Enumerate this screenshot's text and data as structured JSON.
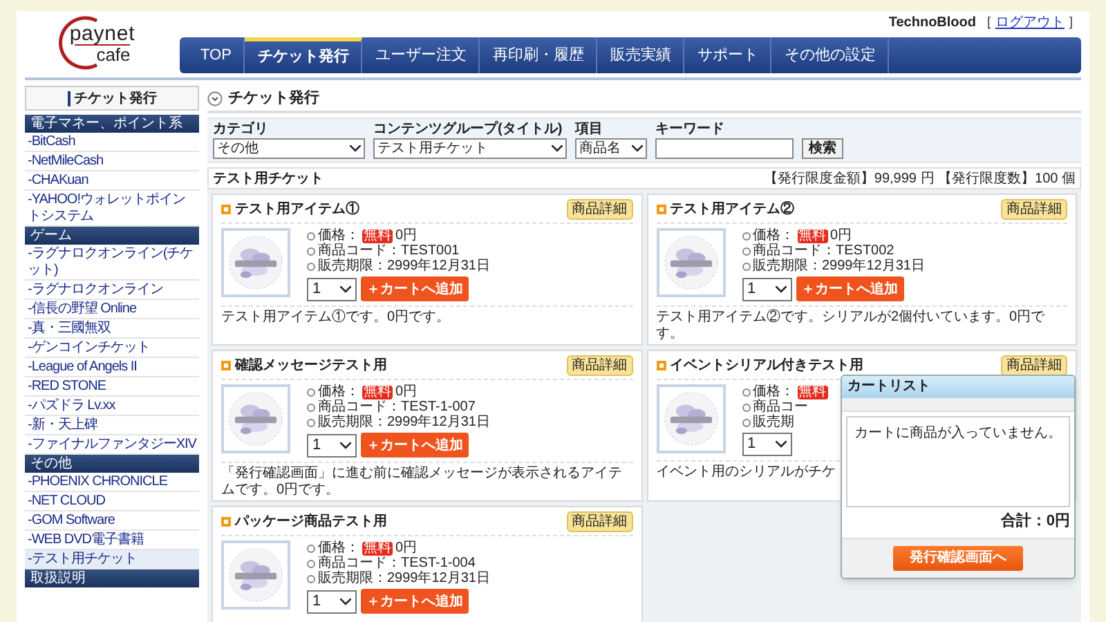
{
  "header": {
    "logo_top": "paynet",
    "logo_bottom": "cafe",
    "user": "TechnoBlood",
    "logout_open": "［",
    "logout": "ログアウト",
    "logout_close": "］"
  },
  "nav": [
    {
      "label": "TOP",
      "selected": false
    },
    {
      "label": "チケット発行",
      "selected": true
    },
    {
      "label": "ユーザー注文",
      "selected": false
    },
    {
      "label": "再印刷・履歴",
      "selected": false
    },
    {
      "label": "販売実績",
      "selected": false
    },
    {
      "label": "サポート",
      "selected": false
    },
    {
      "label": "その他の設定",
      "selected": false
    }
  ],
  "sidebar": {
    "title": "チケット発行",
    "sections": [
      {
        "heading": "電子マネー、ポイント系",
        "items": [
          {
            "label": "-BitCash",
            "selected": false
          },
          {
            "label": "-NetMileCash",
            "selected": false
          },
          {
            "label": "-CHAKuan",
            "selected": false
          },
          {
            "label": "-YAHOO!ウォレットポイントシステム",
            "selected": false
          }
        ]
      },
      {
        "heading": "ゲーム",
        "items": [
          {
            "label": "-ラグナロクオンライン(チケット)",
            "selected": false
          },
          {
            "label": "-ラグナロクオンライン",
            "selected": false
          },
          {
            "label": "-信長の野望 Online",
            "selected": false
          },
          {
            "label": "-真・三國無双",
            "selected": false
          },
          {
            "label": "-ゲンコインチケット",
            "selected": false
          },
          {
            "label": "-League of Angels II",
            "selected": false
          },
          {
            "label": "-RED STONE",
            "selected": false
          },
          {
            "label": "-パズドラ Lv.xx",
            "selected": false
          },
          {
            "label": "-新・天上碑",
            "selected": false
          },
          {
            "label": "-ファイナルファンタジーXIV",
            "selected": false
          }
        ]
      },
      {
        "heading": "その他",
        "items": [
          {
            "label": "-PHOENIX CHRONICLE",
            "selected": false
          },
          {
            "label": "-NET CLOUD",
            "selected": false
          },
          {
            "label": "-GOM Software",
            "selected": false
          },
          {
            "label": "-WEB DVD電子書籍",
            "selected": false
          },
          {
            "label": "-テスト用チケット",
            "selected": true
          }
        ]
      },
      {
        "heading": "取扱説明"
      }
    ]
  },
  "page_title": "チケット発行",
  "filters": {
    "fields": [
      {
        "label": "カテゴリ",
        "value": "その他"
      },
      {
        "label": "コンテンツグループ(タイトル)",
        "value": "テスト用チケット"
      },
      {
        "label": "項目",
        "value": "商品名"
      }
    ],
    "keyword_label": "キーワード",
    "search_button": "検索"
  },
  "section": {
    "title": "テスト用チケット",
    "limits": "【発行限度金額】99,999 円 【発行限度数】100 個"
  },
  "products": [
    {
      "name": "テスト用アイテム①",
      "detail": "商品詳細",
      "price_label": "価格：",
      "badge": "無料",
      "price": "0円",
      "code": "商品コード：TEST001",
      "period": "販売期限：2999年12月31日",
      "qty": "1",
      "add": "＋カートへ追加",
      "description": "テスト用アイテム①です。0円です。"
    },
    {
      "name": "テスト用アイテム②",
      "detail": "商品詳細",
      "price_label": "価格：",
      "badge": "無料",
      "price": "0円",
      "code": "商品コード：TEST002",
      "period": "販売期限：2999年12月31日",
      "qty": "1",
      "add": "＋カートへ追加",
      "description": "テスト用アイテム②です。シリアルが2個付いています。0円です。"
    },
    {
      "name": "確認メッセージテスト用",
      "detail": "商品詳細",
      "price_label": "価格：",
      "badge": "無料",
      "price": "0円",
      "code": "商品コード：TEST-1-007",
      "period": "販売期限：2999年12月31日",
      "qty": "1",
      "add": "＋カートへ追加",
      "description": "「発行確認画面」に進む前に確認メッセージが表示されるアイテムです。0円です。"
    },
    {
      "name": "イベントシリアル付きテスト用",
      "detail": "商品詳細",
      "price_label": "価格：",
      "badge": "無料",
      "code": "商品コー",
      "period": "販売期",
      "qty": "1",
      "description": "イベント用のシリアルがチケ"
    },
    {
      "name": "パッケージ商品テスト用",
      "detail": "商品詳細",
      "price_label": "価格：",
      "badge": "無料",
      "price": "0円",
      "code": "商品コード：TEST-1-004",
      "period": "販売期限：2999年12月31日",
      "qty": "1",
      "add": "＋カートへ追加"
    }
  ],
  "cart": {
    "title": "カートリスト",
    "empty_message": "カートに商品が入っていません。",
    "total": "合計：0円",
    "checkout": "発行確認画面へ"
  }
}
